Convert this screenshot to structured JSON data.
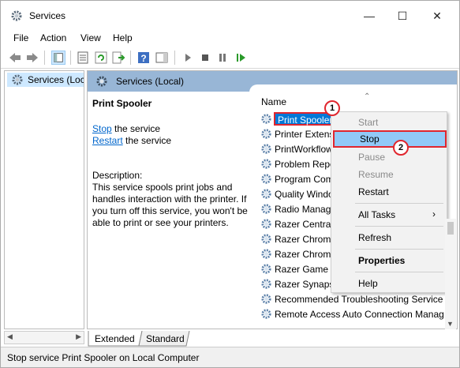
{
  "window": {
    "title": "Services"
  },
  "menu": [
    "File",
    "Action",
    "View",
    "Help"
  ],
  "tree": {
    "selected_label": "Services (Local)"
  },
  "header": {
    "title": "Services (Local)"
  },
  "detail": {
    "service_name": "Print Spooler",
    "stop_link": "Stop",
    "stop_suffix": " the service",
    "restart_link": "Restart",
    "restart_suffix": " the service",
    "description_label": "Description:",
    "description": "This service spools print jobs and handles interaction with the printer. If you turn off this service, you won't be able to print or see your printers."
  },
  "list": {
    "column_name": "Name",
    "rows": [
      "Print Spooler",
      "Printer Extens",
      "PrintWorkflow",
      "Problem Repo",
      "Program Com",
      "Quality Windo",
      "Radio Manage",
      "Razer Central",
      "Razer Chroma",
      "Razer Chroma",
      "Razer Game M",
      "Razer Synapse",
      "Recommended Troubleshooting Service",
      "Remote Access Auto Connection Manag"
    ]
  },
  "context_menu": {
    "items": [
      "Start",
      "Stop",
      "Pause",
      "Resume",
      "Restart",
      "All Tasks",
      "Refresh",
      "Properties",
      "Help"
    ]
  },
  "callouts": [
    "1",
    "2"
  ],
  "tabs": {
    "extended": "Extended",
    "standard": "Standard"
  },
  "status": {
    "text": "Stop service Print Spooler on Local Computer"
  },
  "colors": {
    "selection": "#0078d7",
    "menu_highlight": "#91c9f7",
    "callout_red": "#e0262e",
    "header_band": "#98b6d6"
  }
}
